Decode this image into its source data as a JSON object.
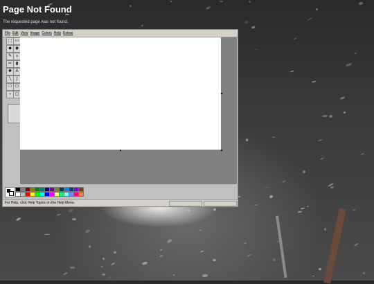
{
  "page": {
    "title": "Page Not Found",
    "subtitle": "The requested page was not found."
  },
  "paint": {
    "menu": [
      "File",
      "Edit",
      "View",
      "Image",
      "Colors",
      "Help",
      "Extras"
    ],
    "status_text": "For Help, click Help Topics on the Help Menu.",
    "tools": [
      {
        "glyph": "⬚",
        "name": "free-select-icon"
      },
      {
        "glyph": "▭",
        "name": "rect-select-icon"
      },
      {
        "glyph": "◆",
        "name": "eraser-icon"
      },
      {
        "glyph": "◉",
        "name": "fill-bucket-icon"
      },
      {
        "glyph": "✎",
        "name": "color-picker-icon"
      },
      {
        "glyph": "⌕",
        "name": "magnifier-icon"
      },
      {
        "glyph": "✏",
        "name": "pencil-icon"
      },
      {
        "glyph": "▮",
        "name": "brush-icon"
      },
      {
        "glyph": "✺",
        "name": "airbrush-icon"
      },
      {
        "glyph": "A",
        "name": "text-icon"
      },
      {
        "glyph": "╲",
        "name": "line-icon"
      },
      {
        "glyph": "∫",
        "name": "curve-icon"
      },
      {
        "glyph": "□",
        "name": "rectangle-icon"
      },
      {
        "glyph": "⬠",
        "name": "polygon-icon"
      },
      {
        "glyph": "○",
        "name": "ellipse-icon"
      },
      {
        "glyph": "▢",
        "name": "rounded-rect-icon"
      }
    ],
    "palette_top": [
      "#000000",
      "#808080",
      "#800000",
      "#808000",
      "#008000",
      "#008080",
      "#000080",
      "#800080",
      "#808040",
      "#004040",
      "#0080ff",
      "#004080",
      "#8000ff",
      "#804000"
    ],
    "palette_bottom": [
      "#ffffff",
      "#c0c0c0",
      "#ff0000",
      "#ffff00",
      "#00ff00",
      "#00ffff",
      "#0000ff",
      "#ff00ff",
      "#ffff80",
      "#00ff80",
      "#80ffff",
      "#8080ff",
      "#ff0080",
      "#ff8040"
    ]
  }
}
